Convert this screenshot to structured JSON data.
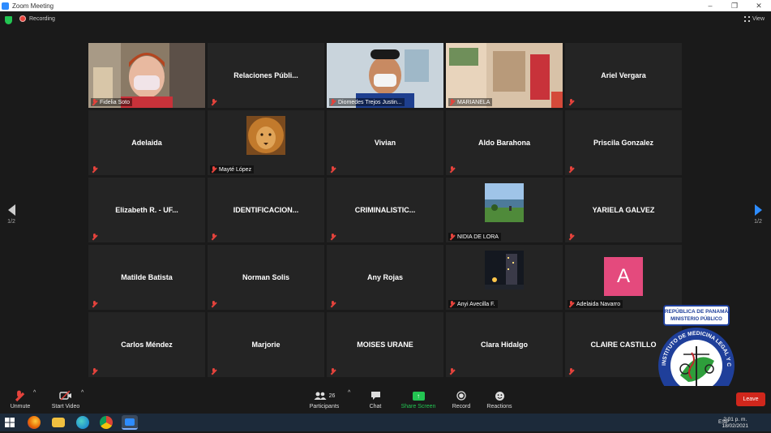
{
  "window": {
    "title": "Zoom Meeting",
    "controls": [
      "–",
      "❐",
      "✕"
    ]
  },
  "topbar": {
    "recording": "Recording",
    "view": "View"
  },
  "pagination": {
    "left": "1/2",
    "right": "1/2"
  },
  "tiles": [
    {
      "name": "Fidelia Soto",
      "label": "Fidelia Soto",
      "type": "video",
      "active": true
    },
    {
      "name": "Relaciones  Públi...",
      "type": "name"
    },
    {
      "name": "Diomedes Trejos Justin...",
      "label": "Diomedes Trejos Justin...",
      "type": "video"
    },
    {
      "name": "MARIANELA",
      "label": "MARIANELA",
      "type": "video"
    },
    {
      "name": "Ariel Vergara",
      "type": "name"
    },
    {
      "name": "Adelaida",
      "type": "name"
    },
    {
      "name": "Mayté López",
      "label": "Mayté López",
      "type": "thumb-lion"
    },
    {
      "name": "Vivian",
      "type": "name"
    },
    {
      "name": "Aldo Barahona",
      "type": "name"
    },
    {
      "name": "Priscila Gonzalez",
      "type": "name"
    },
    {
      "name": "Elizabeth R. - UF...",
      "type": "name"
    },
    {
      "name": "IDENTIFICACION...",
      "type": "name"
    },
    {
      "name": "CRIMINALISTIC...",
      "type": "name"
    },
    {
      "name": "NIDIA DE LORA",
      "label": "NIDIA DE LORA",
      "type": "thumb-lake"
    },
    {
      "name": "YARIELA GALVEZ",
      "type": "name"
    },
    {
      "name": "Matilde Batista",
      "type": "name"
    },
    {
      "name": "Norman Solis",
      "type": "name"
    },
    {
      "name": "Any Rojas",
      "type": "name"
    },
    {
      "name": "Anyi Avecilla F.",
      "label": "Anyi Avecilla F.",
      "type": "thumb-night"
    },
    {
      "name": "Adelaida Navarro",
      "label": "Adelaida Navarro",
      "type": "avatar",
      "avatar_letter": "A"
    },
    {
      "name": "Carlos Méndez",
      "type": "name"
    },
    {
      "name": "Marjorie",
      "type": "name"
    },
    {
      "name": "MOISES URANE",
      "type": "name"
    },
    {
      "name": "Clara Hidalgo",
      "type": "name"
    },
    {
      "name": "CLAIRE CASTILLO",
      "type": "name"
    }
  ],
  "toolbar": {
    "unmute": "Unmute",
    "start_video": "Start Video",
    "participants": "Participants",
    "participants_count": "26",
    "chat": "Chat",
    "share_screen": "Share Screen",
    "record": "Record",
    "reactions": "Reactions",
    "leave": "Leave"
  },
  "seal": {
    "line1": "REPÚBLICA DE PANAMÁ",
    "line2": "MINISTERIO PÚBLICO",
    "arc": "INSTITUTO DE MEDICINA LEGAL Y CIENCIAS FORENSES"
  },
  "taskbar": {
    "time": "2:01 p. m.",
    "date": "18/02/2021",
    "lang": "ESP"
  },
  "colors": {
    "active_border": "#bde337",
    "share": "#23c552",
    "leave": "#d0271c",
    "muted": "#e5433c",
    "avatar": "#e44a7d"
  }
}
